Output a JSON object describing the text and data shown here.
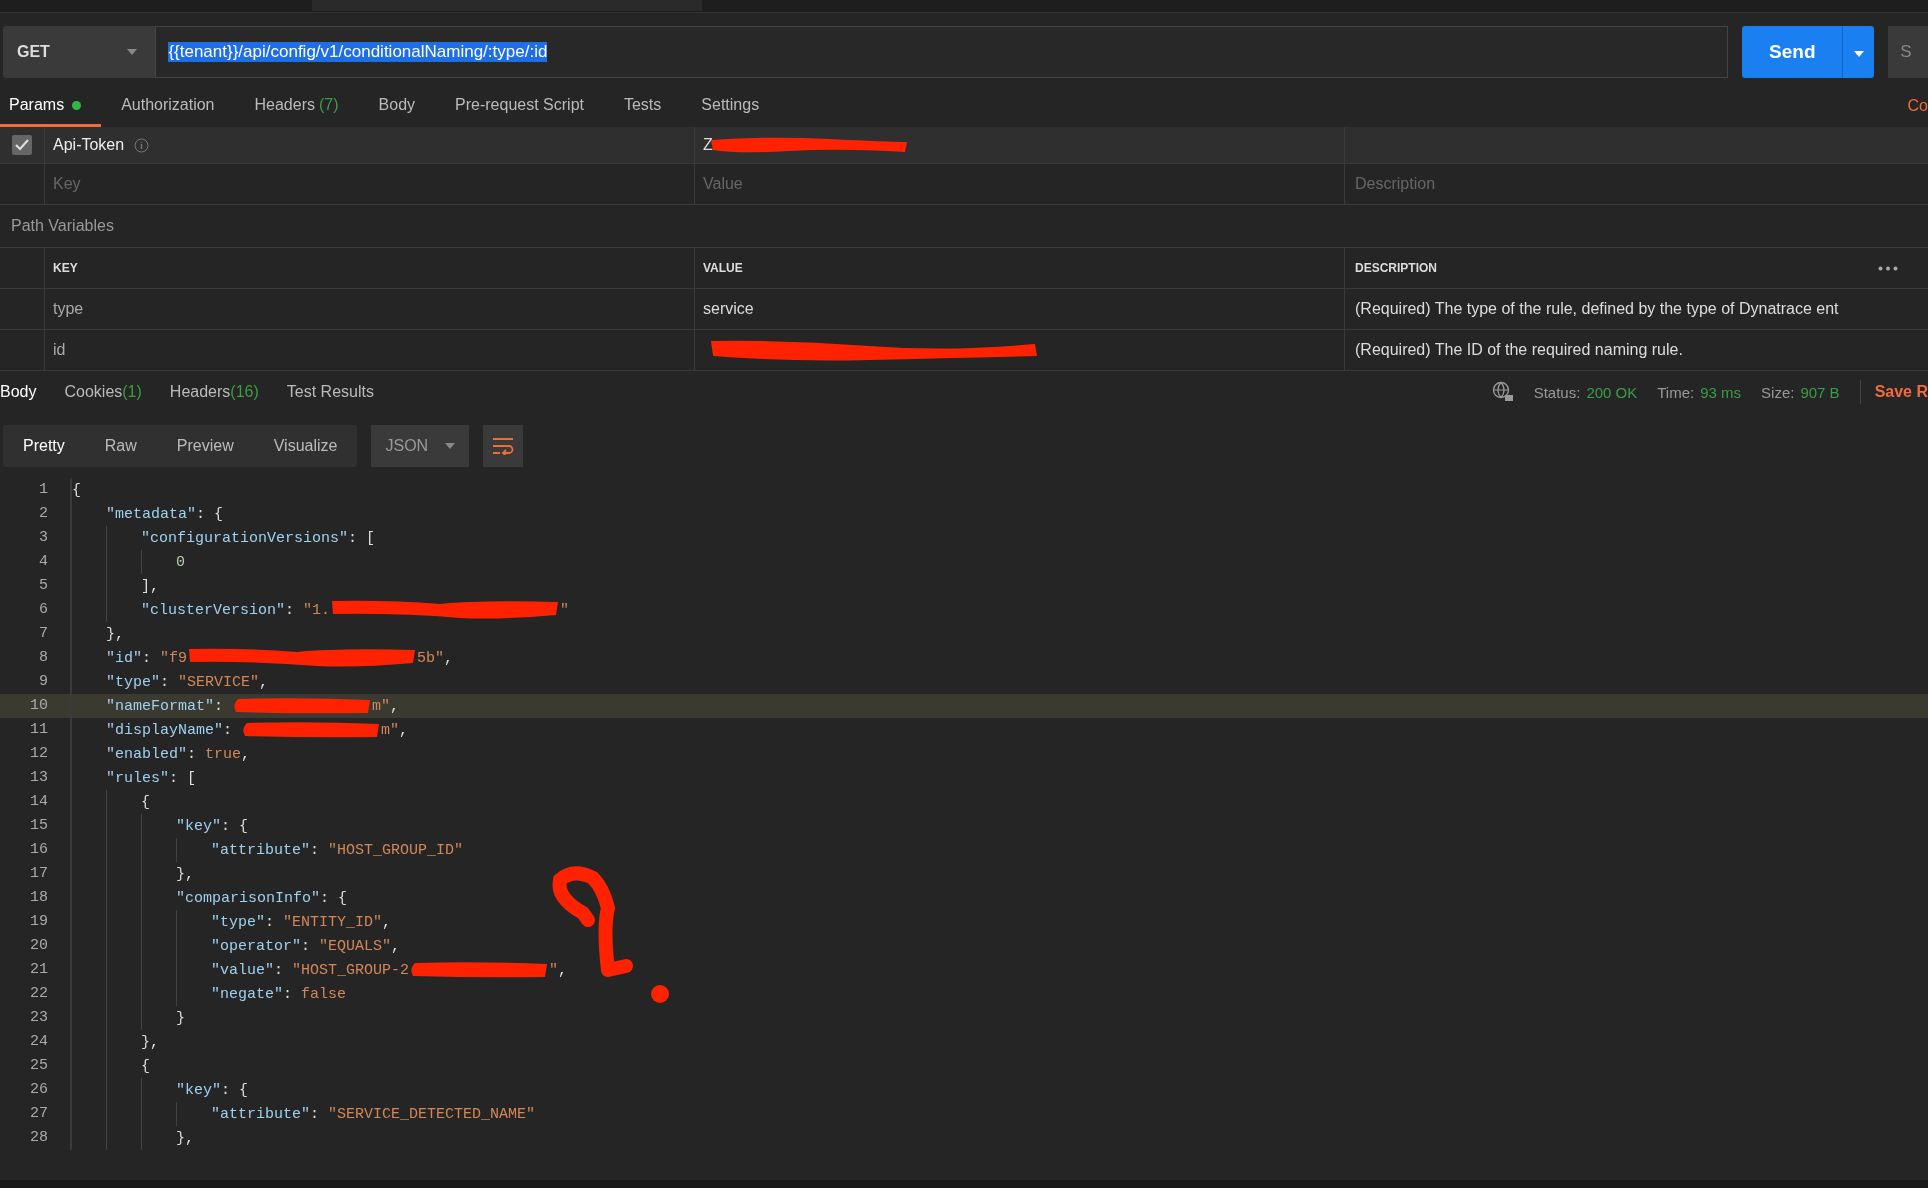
{
  "request": {
    "method": "GET",
    "url": "{{tenant}}/api/config/v1/conditionalNaming/:type/:id",
    "send": "Send",
    "cut_button": "S"
  },
  "request_tabs": [
    {
      "label": "Params",
      "dot": true,
      "selected": true
    },
    {
      "label": "Authorization",
      "dot": false,
      "selected": false
    },
    {
      "label": "Headers",
      "count": "(7)",
      "dot": false,
      "selected": false
    },
    {
      "label": "Body",
      "dot": false,
      "selected": false
    },
    {
      "label": "Pre-request Script",
      "dot": false,
      "selected": false
    },
    {
      "label": "Tests",
      "dot": false,
      "selected": false
    },
    {
      "label": "Settings",
      "dot": false,
      "selected": false
    }
  ],
  "code_link": "Co",
  "params": {
    "rows": [
      {
        "checked": true,
        "key": "Api-Token",
        "value": "Z",
        "redacted": true
      }
    ],
    "placeholders": {
      "key": "Key",
      "value": "Value",
      "description": "Description"
    }
  },
  "path_variables": {
    "title": "Path Variables",
    "columns": [
      "KEY",
      "VALUE",
      "DESCRIPTION"
    ],
    "rows": [
      {
        "key": "type",
        "value": "service",
        "redacted": false,
        "description": "(Required) The type of the rule, defined by the type of Dynatrace ent"
      },
      {
        "key": "id",
        "redacted": true,
        "description": "(Required) The ID of the required naming rule."
      }
    ]
  },
  "response_tabs": [
    {
      "label": "Body",
      "selected": true
    },
    {
      "label": "Cookies",
      "count": "(1)",
      "selected": false
    },
    {
      "label": "Headers",
      "count": "(16)",
      "selected": false
    },
    {
      "label": "Test Results",
      "selected": false
    }
  ],
  "status": [
    {
      "label": "Status:",
      "value": "200 OK"
    },
    {
      "label": "Time:",
      "value": "93 ms"
    },
    {
      "label": "Size:",
      "value": "907 B"
    }
  ],
  "save_link": "Save R",
  "view_modes": [
    {
      "label": "Pretty",
      "selected": true
    },
    {
      "label": "Raw",
      "selected": false
    },
    {
      "label": "Preview",
      "selected": false
    },
    {
      "label": "Visualize",
      "selected": false
    }
  ],
  "format": "JSON",
  "code": [
    {
      "n": "1",
      "highlighted": false,
      "tokens": [
        {
          "kind": "punct",
          "text": "{"
        }
      ],
      "children": [
        {
          "n": "2",
          "highlighted": false,
          "tokens": [
            {
              "kind": "key",
              "text": "\"metadata\""
            },
            {
              "kind": "punct",
              "text": ": {"
            }
          ],
          "children": [
            {
              "n": "3",
              "highlighted": false,
              "tokens": [
                {
                  "kind": "key",
                  "text": "\"configurationVersions\""
                },
                {
                  "kind": "punct",
                  "text": ": ["
                }
              ],
              "children": [
                {
                  "n": "4",
                  "highlighted": false,
                  "tokens": [
                    {
                      "kind": "number",
                      "text": "0"
                    }
                  ]
                }
              ]
            },
            {
              "n": "5",
              "highlighted": false,
              "tokens": [
                {
                  "kind": "punct",
                  "text": "],"
                }
              ]
            },
            {
              "n": "6",
              "highlighted": false,
              "tokens": [
                {
                  "kind": "key",
                  "text": "\"clusterVersion\""
                },
                {
                  "kind": "punct",
                  "text": ": "
                },
                {
                  "kind": "string",
                  "text": "\"1."
                },
                {
                  "kind": "redaction_long"
                },
                {
                  "kind": "string",
                  "text": "\""
                }
              ]
            }
          ]
        },
        {
          "n": "7",
          "highlighted": false,
          "tokens": [
            {
              "kind": "punct",
              "text": "},"
            }
          ]
        },
        {
          "n": "8",
          "highlighted": false,
          "tokens": [
            {
              "kind": "key",
              "text": "\"id\""
            },
            {
              "kind": "punct",
              "text": ": "
            },
            {
              "kind": "string",
              "text": "\"f9"
            },
            {
              "kind": "redaction_long"
            },
            {
              "kind": "string",
              "text": "5b\""
            },
            {
              "kind": "punct",
              "text": ","
            }
          ]
        },
        {
          "n": "9",
          "highlighted": false,
          "tokens": [
            {
              "kind": "key",
              "text": "\"type\""
            },
            {
              "kind": "punct",
              "text": ": "
            },
            {
              "kind": "string",
              "text": "\"SERVICE\""
            },
            {
              "kind": "punct",
              "text": ","
            }
          ]
        },
        {
          "n": "10",
          "highlighted": true,
          "tokens": [
            {
              "kind": "key",
              "text": "\"nameFormat\""
            },
            {
              "kind": "punct",
              "text": ": "
            },
            {
              "kind": "redaction"
            },
            {
              "kind": "string",
              "text": "m\""
            },
            {
              "kind": "punct",
              "text": ","
            }
          ]
        },
        {
          "n": "11",
          "highlighted": false,
          "tokens": [
            {
              "kind": "key",
              "text": "\"displayName\""
            },
            {
              "kind": "punct",
              "text": ": "
            },
            {
              "kind": "redaction"
            },
            {
              "kind": "string",
              "text": "m\""
            },
            {
              "kind": "punct",
              "text": ","
            }
          ]
        },
        {
          "n": "12",
          "highlighted": false,
          "tokens": [
            {
              "kind": "key",
              "text": "\"enabled\""
            },
            {
              "kind": "punct",
              "text": ": "
            },
            {
              "kind": "bool",
              "text": "true"
            },
            {
              "kind": "punct",
              "text": ","
            }
          ]
        },
        {
          "n": "13",
          "highlighted": false,
          "tokens": [
            {
              "kind": "key",
              "text": "\"rules\""
            },
            {
              "kind": "punct",
              "text": ": ["
            }
          ],
          "children": [
            {
              "n": "14",
              "highlighted": false,
              "tokens": [
                {
                  "kind": "punct",
                  "text": "{"
                }
              ],
              "children": [
                {
                  "n": "15",
                  "highlighted": false,
                  "tokens": [
                    {
                      "kind": "key",
                      "text": "\"key\""
                    },
                    {
                      "kind": "punct",
                      "text": ": {"
                    }
                  ],
                  "children": [
                    {
                      "n": "16",
                      "highlighted": false,
                      "tokens": [
                        {
                          "kind": "key",
                          "text": "\"attribute\""
                        },
                        {
                          "kind": "punct",
                          "text": ": "
                        },
                        {
                          "kind": "string",
                          "text": "\"HOST_GROUP_ID\""
                        }
                      ]
                    }
                  ]
                },
                {
                  "n": "17",
                  "highlighted": false,
                  "tokens": [
                    {
                      "kind": "punct",
                      "text": "},"
                    }
                  ]
                },
                {
                  "n": "18",
                  "highlighted": false,
                  "tokens": [
                    {
                      "kind": "key",
                      "text": "\"comparisonInfo\""
                    },
                    {
                      "kind": "punct",
                      "text": ": {"
                    }
                  ],
                  "children": [
                    {
                      "n": "19",
                      "highlighted": false,
                      "tokens": [
                        {
                          "kind": "key",
                          "text": "\"type\""
                        },
                        {
                          "kind": "punct",
                          "text": ": "
                        },
                        {
                          "kind": "string",
                          "text": "\"ENTITY_ID\""
                        },
                        {
                          "kind": "punct",
                          "text": ","
                        }
                      ]
                    },
                    {
                      "n": "20",
                      "highlighted": false,
                      "tokens": [
                        {
                          "kind": "key",
                          "text": "\"operator\""
                        },
                        {
                          "kind": "punct",
                          "text": ": "
                        },
                        {
                          "kind": "string",
                          "text": "\"EQUALS\""
                        },
                        {
                          "kind": "punct",
                          "text": ","
                        }
                      ]
                    },
                    {
                      "n": "21",
                      "highlighted": false,
                      "tokens": [
                        {
                          "kind": "key",
                          "text": "\"value\""
                        },
                        {
                          "kind": "punct",
                          "text": ": "
                        },
                        {
                          "kind": "string",
                          "text": "\"HOST_GROUP-2"
                        },
                        {
                          "kind": "redaction"
                        },
                        {
                          "kind": "string",
                          "text": "\""
                        },
                        {
                          "kind": "punct",
                          "text": ","
                        }
                      ]
                    },
                    {
                      "n": "22",
                      "highlighted": false,
                      "tokens": [
                        {
                          "kind": "key",
                          "text": "\"negate\""
                        },
                        {
                          "kind": "punct",
                          "text": ": "
                        },
                        {
                          "kind": "bool",
                          "text": "false"
                        }
                      ]
                    }
                  ]
                },
                {
                  "n": "23",
                  "highlighted": false,
                  "tokens": [
                    {
                      "kind": "punct",
                      "text": "}"
                    }
                  ]
                }
              ]
            },
            {
              "n": "24",
              "highlighted": false,
              "tokens": [
                {
                  "kind": "punct",
                  "text": "},"
                }
              ]
            },
            {
              "n": "25",
              "highlighted": false,
              "tokens": [
                {
                  "kind": "punct",
                  "text": "{"
                }
              ],
              "children": [
                {
                  "n": "26",
                  "highlighted": false,
                  "tokens": [
                    {
                      "kind": "key",
                      "text": "\"key\""
                    },
                    {
                      "kind": "punct",
                      "text": ": {"
                    }
                  ],
                  "children": [
                    {
                      "n": "27",
                      "highlighted": false,
                      "tokens": [
                        {
                          "kind": "key",
                          "text": "\"attribute\""
                        },
                        {
                          "kind": "punct",
                          "text": ": "
                        },
                        {
                          "kind": "string",
                          "text": "\"SERVICE_DETECTED_NAME\""
                        }
                      ]
                    }
                  ]
                },
                {
                  "n": "28",
                  "highlighted": false,
                  "tokens": [
                    {
                      "kind": "punct",
                      "text": "},"
                    }
                  ]
                }
              ]
            }
          ]
        }
      ]
    }
  ]
}
